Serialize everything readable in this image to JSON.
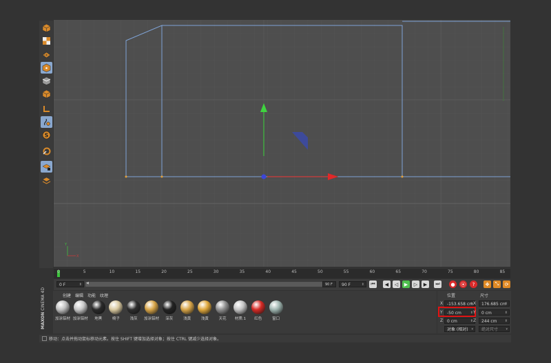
{
  "timeline": {
    "ticks": [
      "0",
      "5",
      "10",
      "15",
      "20",
      "25",
      "30",
      "35",
      "40",
      "45",
      "50",
      "55",
      "60",
      "65",
      "70",
      "75",
      "80",
      "85"
    ],
    "current_frame": "0"
  },
  "transport": {
    "start_frame": "0 F",
    "end_frame_inner": "90 F",
    "end_frame": "90 F"
  },
  "materials": {
    "menu": [
      "创建",
      "编辑",
      "功能",
      "纹理"
    ],
    "items": [
      {
        "label": "加涂铝材",
        "color": "#bfbfbf"
      },
      {
        "label": "加涂铝材",
        "color": "#c7c7c7"
      },
      {
        "label": "地黑",
        "color": "#2a2a2a"
      },
      {
        "label": "椅子",
        "color": "#d9c9a0"
      },
      {
        "label": "浅灰",
        "color": "#2e2e2e"
      },
      {
        "label": "加涂铝材",
        "color": "#d8a548"
      },
      {
        "label": "深灰",
        "color": "#232323"
      },
      {
        "label": "浅黄",
        "color": "#d8a548"
      },
      {
        "label": "浅黄",
        "color": "#e0a83c"
      },
      {
        "label": "天花",
        "color": "#8f8f8f"
      },
      {
        "label": "材质.1",
        "color": "#c4c4c4"
      },
      {
        "label": "红色",
        "color": "#d62a25"
      },
      {
        "label": "窗口",
        "color": "#9fb5b0"
      }
    ],
    "brand_top": "MAXON",
    "brand_bottom": "CINEMA 4D"
  },
  "coordinates": {
    "position_header": "位置",
    "size_header": "尺寸",
    "pos_x_axis": "X",
    "pos_x": "-153.658 cm",
    "pos_y_axis": "Y",
    "pos_y": "-50 cm",
    "pos_z_axis": "Z",
    "pos_z": "0 cm",
    "size_x_axis": "X",
    "size_x": "176.685 cm",
    "size_y_axis": "Y",
    "size_y": "0 cm",
    "size_z_axis": "Z",
    "size_z": "244 cm",
    "mode": "对象 (相对)",
    "size_mode": "绝对尺寸",
    "highlight_color": "#e21212"
  },
  "status": {
    "text": "移动：点击并拖动鼠标移动元素。按住 SHIFT 键增加选择对象；按住 CTRL 键减少选择对象。"
  }
}
